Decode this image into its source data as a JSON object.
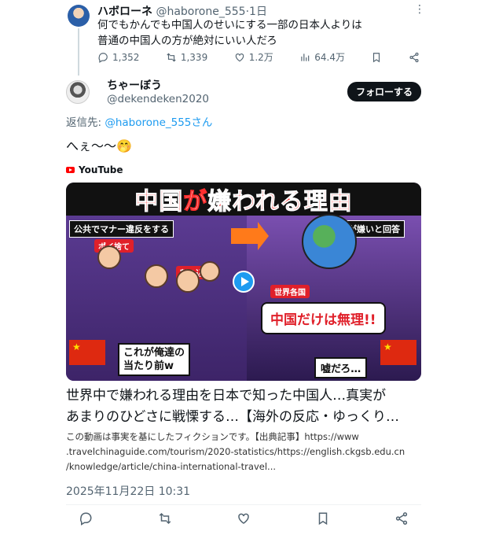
{
  "parent_tweet": {
    "name": "ハボローネ",
    "handle": "@haborone_555",
    "time": "1日",
    "text_line1": "何でもかんでも中国人のせいにする一部の日本人よりは",
    "text_line2": "普通の中国人の方が絶対にいい人だろ",
    "replies": "1,352",
    "retweets": "1,339",
    "likes": "1.2万",
    "views": "64.4万"
  },
  "main_tweet": {
    "name": "ちゃーぼう",
    "handle": "@dekendeken2020",
    "follow_label": "フォローする",
    "reply_prefix": "返信先: ",
    "reply_to": "@haborone_555さん",
    "text": "へぇ〜〜🤭",
    "timestamp": "2025年11月22日 10:31"
  },
  "card": {
    "source": "YouTube",
    "thumb_title_red1": "中国",
    "thumb_title_white": "が",
    "thumb_title_red2": "嫌われる理由",
    "cap_left": "公共でマナー違反をする",
    "tag_poi": "ポイ捨て",
    "tag_cut": "割り込み",
    "bubble_left_l1": "これが俺達の",
    "bubble_left_l2": "当たり前w",
    "cap_right": "世界中が嫌いと回答",
    "tag_world": "世界各国",
    "bubble_right": "中国だけは無理!!",
    "bubble_small": "嘘だろ…",
    "title_line1": "世界中で嫌われる理由を日本で知った中国人…真実が",
    "title_line2": "あまりのひどさに戦慄する…【海外の反応・ゆっくり…",
    "desc_line1": "この動画は事実を基にしたフィクションです。【出典記事】https://www",
    "desc_line2": ".travelchinaguide.com/tourism/2020-statistics/https://english.ckgsb.edu.cn",
    "desc_line3": "/knowledge/article/china-international-travel..."
  },
  "icons": [
    "reply-icon",
    "retweet-icon",
    "like-icon",
    "views-icon",
    "bookmark-icon",
    "share-icon",
    "more-icon",
    "play-icon"
  ],
  "colors": {
    "accent": "#1d9bf0",
    "text": "#0f1419",
    "muted": "#536471",
    "yt_red": "#ff0000"
  }
}
